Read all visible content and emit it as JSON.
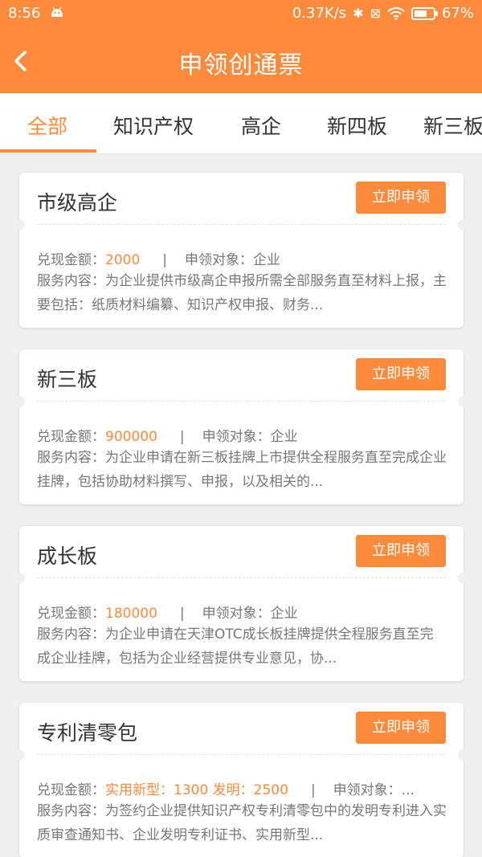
{
  "status": {
    "time": "8:56",
    "speed": "0.37K/s",
    "battery": "67%",
    "battery_level": 0.67
  },
  "header": {
    "title": "申领创通票"
  },
  "tabs": [
    {
      "label": "全部",
      "active": true
    },
    {
      "label": "知识产权"
    },
    {
      "label": "高企"
    },
    {
      "label": "新四板"
    },
    {
      "label": "新三板"
    }
  ],
  "cards": [
    {
      "title": "市级高企",
      "button": "立即申领",
      "amount_label": "兑现金额：",
      "amount": "2000",
      "pipe": "|",
      "target": "申领对象：企业",
      "desc": "服务内容：为企业提供市级高企申报所需全部服务直至材料上报，主要包括：纸质材料编纂、知识产权申报、财务..."
    },
    {
      "title": "新三板",
      "button": "立即申领",
      "amount_label": "兑现金额：",
      "amount": "900000",
      "pipe": "|",
      "target": "申领对象：企业",
      "desc": "服务内容：为企业申请在新三板挂牌上市提供全程服务直至完成企业挂牌，包括协助材料撰写、申报，以及相关的..."
    },
    {
      "title": "成长板",
      "button": "立即申领",
      "amount_label": "兑现金额：",
      "amount": "180000",
      "pipe": "|",
      "target": "申领对象：企业",
      "desc": "服务内容：为企业申请在天津OTC成长板挂牌提供全程服务直至完成企业挂牌，包括为企业经营提供专业意见，协..."
    },
    {
      "title": "专利清零包",
      "button": "立即申领",
      "amount_label": "兑现金额：",
      "amount": "实用新型：1300  发明：2500",
      "pipe": "|",
      "target": "申领对象：...",
      "desc": "服务内容：为签约企业提供知识产权专利清零包中的发明专利进入实质审查通知书、企业发明专利证书、实用新型..."
    }
  ]
}
